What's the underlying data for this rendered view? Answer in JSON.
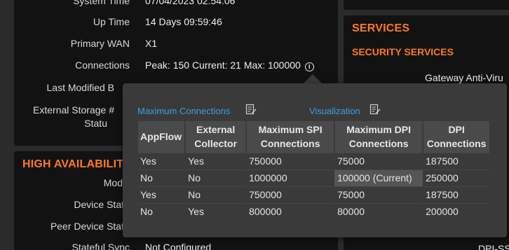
{
  "system": {
    "rows": [
      {
        "label": "System Time",
        "value": "07/04/2023 02:54:06"
      },
      {
        "label": "Up Time",
        "value": "14 Days 09:59:46"
      },
      {
        "label": "Primary WAN",
        "value": "X1"
      },
      {
        "label": "Connections",
        "value": "Peak: 150 Current: 21 Max: 100000"
      },
      {
        "label": "Last Modified B",
        "value": ""
      },
      {
        "label": "External Storage #",
        "value": ""
      },
      {
        "label": "Statu",
        "value": ""
      }
    ],
    "info_icon_glyph": "i"
  },
  "high_availability": {
    "title": "HIGH AVAILABILITY",
    "rows": [
      {
        "label": "Mod",
        "value": ""
      },
      {
        "label": "Device Stat",
        "value": ""
      },
      {
        "label": "Peer Device Stat",
        "value": ""
      },
      {
        "label": "Stateful Sync",
        "value": "Not Configured"
      }
    ]
  },
  "services": {
    "title": "SERVICES",
    "subtitle": "SECURITY SERVICES",
    "item": "Gateway Anti-Viru",
    "bottom_fragment": "DPI-SS"
  },
  "popover": {
    "link_max": "Maximum Connections",
    "link_vis": "Visualization",
    "headers": [
      "AppFlow",
      "External Collector",
      "Maximum SPI Connections",
      "Maximum DPI Connections",
      "DPI Connections"
    ],
    "rows": [
      [
        "Yes",
        "Yes",
        "750000",
        "75000",
        "187500"
      ],
      [
        "No",
        "No",
        "1000000",
        "100000 (Current)",
        "250000"
      ],
      [
        "Yes",
        "No",
        "750000",
        "75000",
        "187500"
      ],
      [
        "No",
        "Yes",
        "800000",
        "80000",
        "200000"
      ]
    ],
    "current_row": 1,
    "current_col": 3
  },
  "colors": {
    "accent": "#ff7a21",
    "link": "#3f9ee0",
    "panel": "#121212",
    "popover": "#3a3a3a"
  }
}
